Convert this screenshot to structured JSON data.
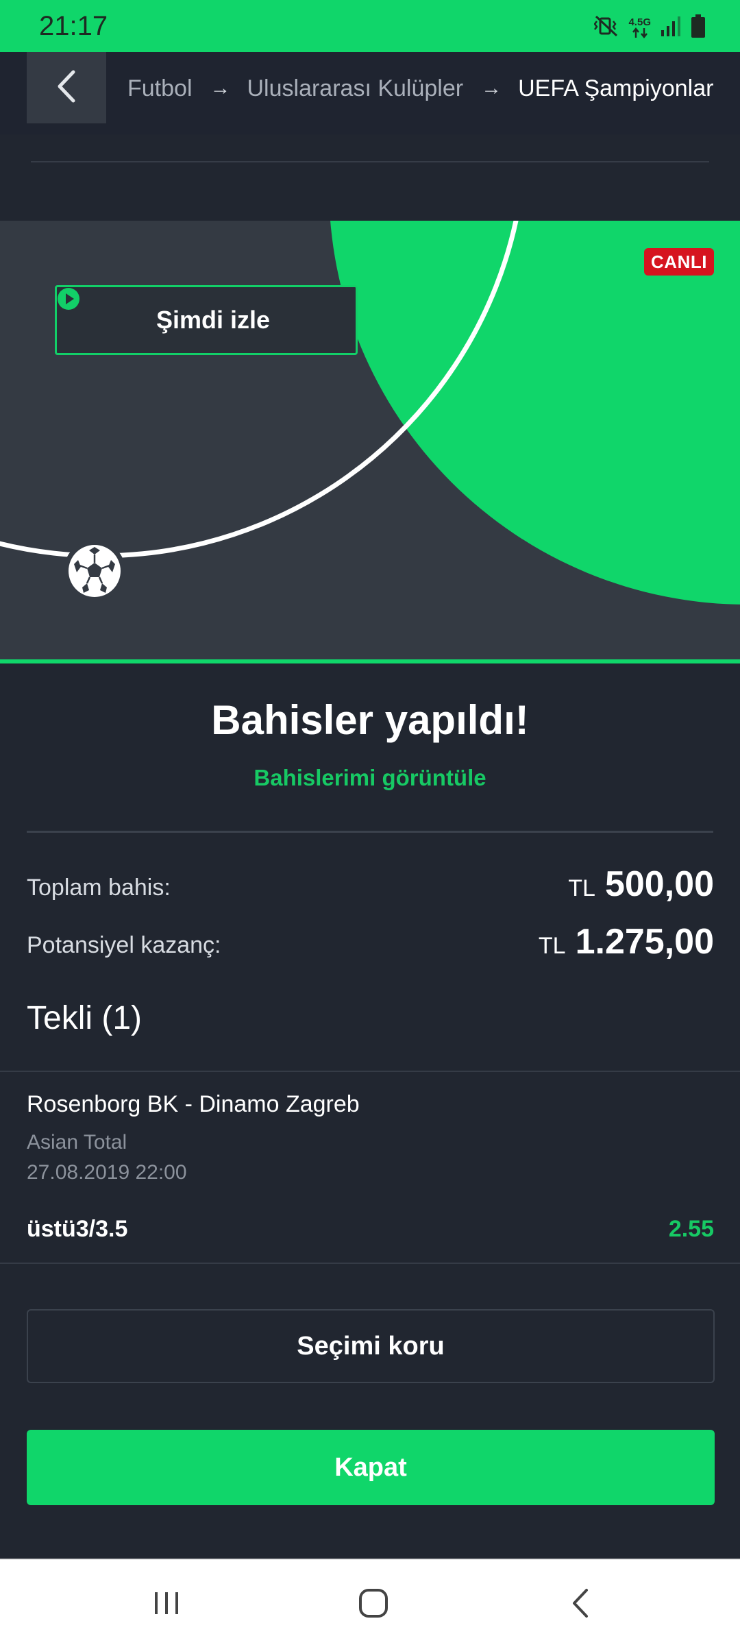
{
  "status_bar": {
    "time": "21:17",
    "network_label": "4.5G",
    "icons": [
      "mute-vibrate-icon",
      "network-4-5g-icon",
      "signal-icon",
      "battery-icon"
    ]
  },
  "header": {
    "back_icon": "chevron-left-icon",
    "breadcrumb": {
      "level1": "Futbol",
      "level2": "Uluslararası Kulüpler",
      "level3": "UEFA Şampiyonlar ...",
      "separator": "→"
    }
  },
  "hero": {
    "live_badge": "CANLI",
    "watch_label": "Şimdi izle",
    "ball_icon": "soccer-ball-icon"
  },
  "result": {
    "title": "Bahisler yapıldı!",
    "view_bets_link": "Bahislerimi görüntüle",
    "total_stake": {
      "label": "Toplam bahis:",
      "currency": "TL",
      "amount": "500,00"
    },
    "potential_win": {
      "label": "Potansiyel kazanç:",
      "currency": "TL",
      "amount": "1.275,00"
    }
  },
  "bet_section": {
    "title": "Tekli (1)",
    "bet": {
      "match": "Rosenborg BK - Dinamo Zagreb",
      "market": "Asian Total",
      "datetime": "27.08.2019 22:00",
      "selection": "üstü3/3.5",
      "odds": "2.55"
    }
  },
  "actions": {
    "keep_selection": "Seçimi koru",
    "close": "Kapat"
  },
  "nav_bar": {
    "icons": [
      "recent-apps-icon",
      "home-icon",
      "back-icon"
    ]
  },
  "colors": {
    "brand_green": "#10d66a",
    "live_red": "#d6141f",
    "background": "#212630",
    "odds_green": "#17c964"
  }
}
